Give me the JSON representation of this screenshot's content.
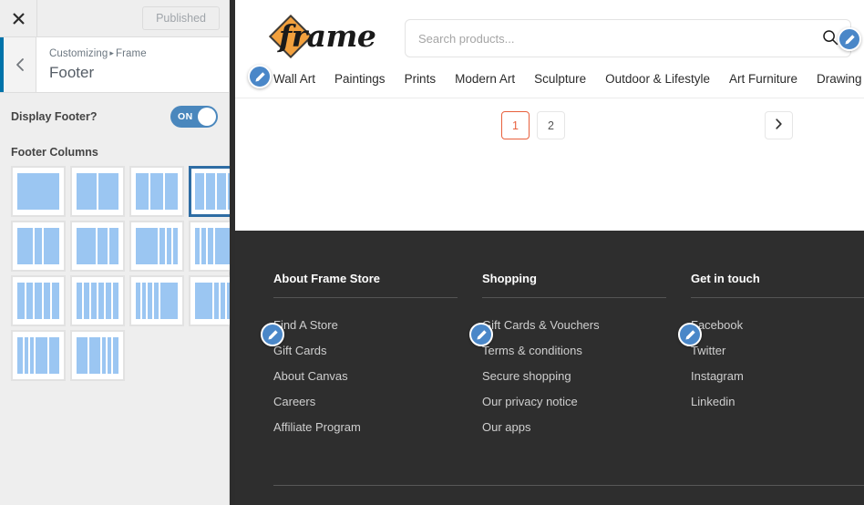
{
  "customizer": {
    "close_icon": "close-x-icon",
    "published_label": "Published",
    "back_icon": "chevron-left-icon",
    "breadcrumb_prefix": "Customizing",
    "breadcrumb_separator": "▸",
    "breadcrumb_theme": "Frame",
    "panel_title": "Footer",
    "display_footer_label": "Display Footer?",
    "display_footer_state": "ON",
    "footer_columns_label": "Footer Columns",
    "accent_blue": "#0073aa",
    "toggle_blue": "#4a87bd",
    "swatch_blue": "#9bc6f2",
    "layouts": [
      {
        "id": "one-column",
        "widths": [
          100
        ],
        "selected": false
      },
      {
        "id": "two-equal",
        "widths": [
          50,
          50
        ],
        "selected": false
      },
      {
        "id": "three-equal",
        "widths": [
          33,
          33,
          33
        ],
        "selected": false
      },
      {
        "id": "four-equal",
        "widths": [
          25,
          25,
          25,
          25
        ],
        "selected": true
      },
      {
        "id": "wide-narrow-wide",
        "widths": [
          36,
          18,
          36
        ],
        "selected": false
      },
      {
        "id": "wide-narrow-narrow",
        "widths": [
          45,
          22,
          22
        ],
        "selected": false
      },
      {
        "id": "wide-three-narrow",
        "widths": [
          52,
          11,
          11,
          11
        ],
        "selected": false
      },
      {
        "id": "three-narrow-wide",
        "widths": [
          11,
          11,
          11,
          52
        ],
        "selected": false
      },
      {
        "id": "five-equal",
        "widths": [
          20,
          20,
          20,
          20,
          20
        ],
        "selected": false
      },
      {
        "id": "six-equal",
        "widths": [
          16,
          16,
          16,
          16,
          16,
          16
        ],
        "selected": false
      },
      {
        "id": "four-narrow-wide",
        "widths": [
          11,
          11,
          11,
          11,
          45
        ],
        "selected": false
      },
      {
        "id": "wide-four-narrow",
        "widths": [
          45,
          11,
          11,
          11,
          11
        ],
        "selected": false
      },
      {
        "id": "narrow-narrow-wide-wide",
        "widths": [
          14,
          9,
          9,
          30,
          24
        ],
        "selected": false
      },
      {
        "id": "wide-wide-narrow-narrow",
        "widths": [
          26,
          26,
          9,
          9,
          14
        ],
        "selected": false
      }
    ]
  },
  "site": {
    "logo_text": "frame",
    "logo_mark": "orange-diamond-icon",
    "search": {
      "placeholder": "Search products...",
      "value": "",
      "icon": "search-icon"
    },
    "nav": [
      "Wall Art",
      "Paintings",
      "Prints",
      "Modern Art",
      "Sculpture",
      "Outdoor & Lifestyle",
      "Art Furniture",
      "Drawing"
    ],
    "pagination": {
      "pages": [
        "1",
        "2"
      ],
      "active": "1",
      "next_icon": "chevron-right-icon",
      "active_color": "#e8603c"
    },
    "footer": {
      "background": "#2e2e2e",
      "columns": [
        {
          "heading": "About Frame Store",
          "links": [
            "Find A Store",
            "Gift Cards",
            "About Canvas",
            "Careers",
            "Affiliate Program"
          ]
        },
        {
          "heading": "Shopping",
          "links": [
            "Gift Cards & Vouchers",
            "Terms & conditions",
            "Secure shopping",
            "Our privacy notice",
            "Our apps"
          ]
        },
        {
          "heading": "Get in touch",
          "links": [
            "Facebook",
            "Twitter",
            "Instagram",
            "Linkedin"
          ]
        }
      ]
    },
    "edit_shortcuts": [
      {
        "id": "nav-menu-edit",
        "icon": "pencil-icon"
      },
      {
        "id": "header-right-edit",
        "icon": "pencil-icon"
      },
      {
        "id": "footer-col1-edit",
        "icon": "pencil-icon"
      },
      {
        "id": "footer-col2-edit",
        "icon": "pencil-icon"
      },
      {
        "id": "footer-col3-edit",
        "icon": "pencil-icon"
      }
    ]
  }
}
